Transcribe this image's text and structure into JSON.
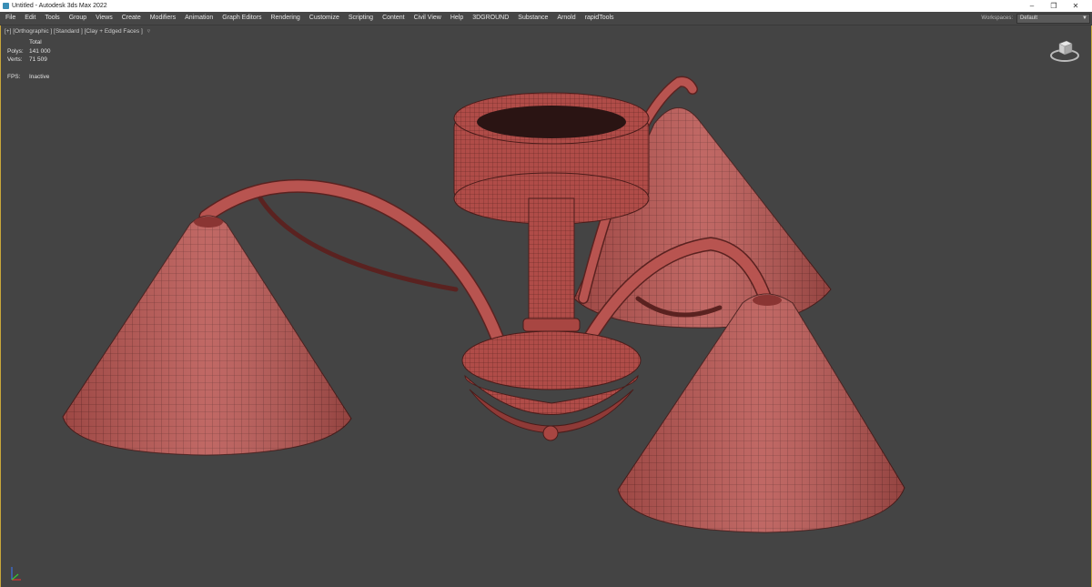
{
  "window": {
    "title": "Untitled - Autodesk 3ds Max 2022",
    "minimize_icon": "minimize-icon",
    "restore_icon": "restore-icon",
    "close_icon": "close-icon"
  },
  "menubar": {
    "items": [
      "File",
      "Edit",
      "Tools",
      "Group",
      "Views",
      "Create",
      "Modifiers",
      "Animation",
      "Graph Editors",
      "Rendering",
      "Customize",
      "Scripting",
      "Content",
      "Civil View",
      "Help",
      "3DGROUND",
      "Substance",
      "Arnold",
      "rapidTools"
    ],
    "workspace_label": "Workspaces:",
    "workspace_value": "Default"
  },
  "viewport": {
    "label": "[+] [Orthographic ] [Standard ] [Clay + Edged Faces ]",
    "filter_icon": "filter-icon",
    "stats": {
      "header": "Total",
      "polys_label": "Polys:",
      "polys_value": "141 000",
      "verts_label": "Verts:",
      "verts_value": "71 509",
      "fps_label": "FPS:",
      "fps_value": "Inactive"
    },
    "model_color": "#b85450",
    "accent_border": "#c8a63a"
  }
}
